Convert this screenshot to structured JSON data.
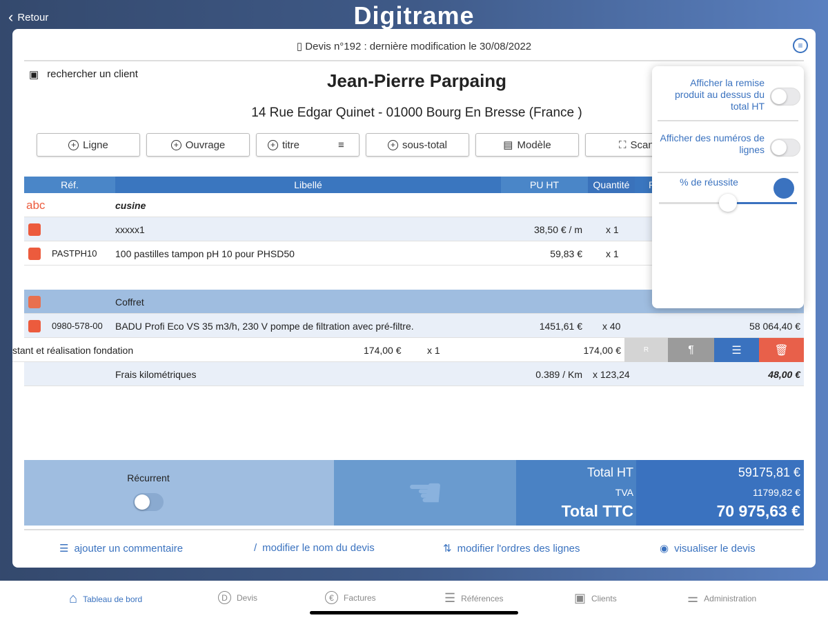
{
  "nav": {
    "back": "Retour",
    "logo": "Digitrame"
  },
  "header": {
    "title": "Devis n°192 : dernière modification le 30/08/2022"
  },
  "client": {
    "search": "rechercher un client",
    "name": "Jean-Pierre Parpaing",
    "address": "14 Rue Edgar Quinet - 01000 Bourg En Bresse (France )"
  },
  "toolbar": [
    "Ligne",
    "Ouvrage",
    "titre",
    "sous-total",
    "Modèle",
    "Scan"
  ],
  "table": {
    "headers": {
      "ref": "Réf.",
      "label": "Libellé",
      "pu": "PU HT",
      "qty": "Quantité",
      "r": "R"
    },
    "rows": [
      {
        "type": "title",
        "icon": "abc",
        "label": "cusine"
      },
      {
        "ref": "",
        "label": "xxxxx1",
        "pu": "38,50 € / m",
        "qty": "x 1"
      },
      {
        "ref": "PASTPH10",
        "label": "100 pastilles tampon pH 10 pour PHSD50",
        "pu": "59,83 €",
        "qty": "x 1"
      },
      {
        "type": "group",
        "label": "Coffret"
      },
      {
        "ref": "0980-578-00",
        "label": "BADU Profi Eco VS 35 m3/h, 230 V pompe de filtration avec pré-filtre.",
        "pu": "1451,61 €",
        "qty": "x 40",
        "total": "58 064,40 €"
      },
      {
        "label": "stant et réalisation fondation",
        "pu": "174,00 €",
        "qty": "x 1",
        "total": "174,00 €"
      },
      {
        "label": "Frais kilométriques",
        "pu": "0.389 / Km",
        "qty": "x 123,24",
        "total": "48,00 €"
      }
    ],
    "swipe_actions": [
      "R",
      "¶",
      "comment",
      "delete"
    ]
  },
  "popover": {
    "remise": "Afficher la remise produit au dessus du total HT",
    "numeros": "Afficher des numéros de lignes",
    "reussite": "% de réussite",
    "remise_on": false,
    "numeros_on": false,
    "reussite_value": 0.5
  },
  "footer": {
    "recurrent": "Récurrent",
    "recurrent_on": false,
    "total_ht_label": "Total HT",
    "total_ht": "59175,81 €",
    "tva_label": "TVA",
    "tva": "11799,82 €",
    "ttc_label": "Total TTC",
    "ttc": "70 975,63 €"
  },
  "links": [
    "ajouter un commentaire",
    "modifier le nom du devis",
    "modifier l'ordres des lignes",
    "visualiser le devis"
  ],
  "tabs": [
    "Tableau de bord",
    "Devis",
    "Factures",
    "Références",
    "Clients",
    "Administration"
  ],
  "colors": {
    "accent": "#3a72bf",
    "danger": "#e8604a"
  }
}
